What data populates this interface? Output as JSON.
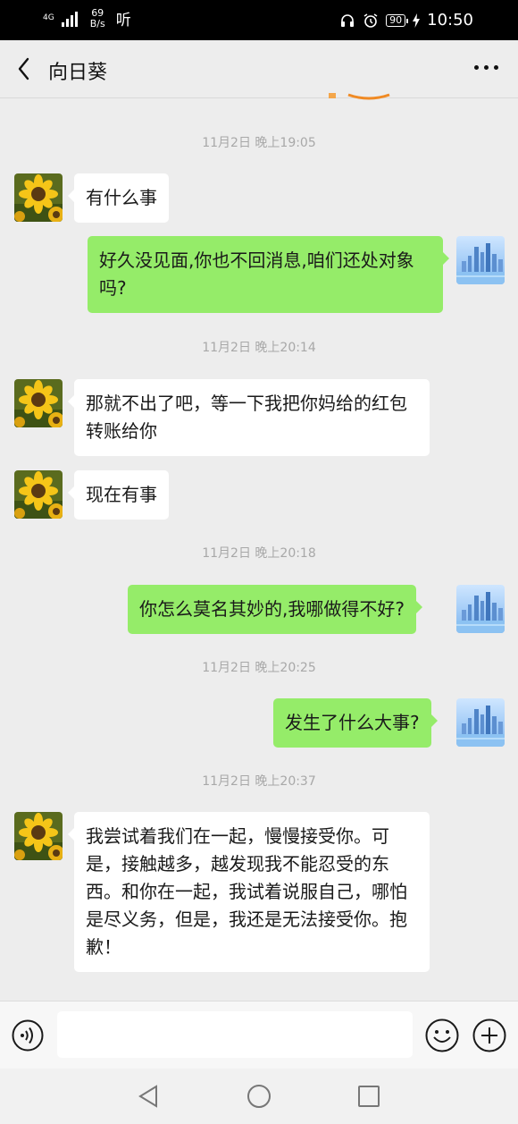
{
  "status_bar": {
    "network_type": "4G",
    "net_speed_value": "69",
    "net_speed_unit": "B/s",
    "hd_label": "听",
    "battery": "90",
    "time": "10:50"
  },
  "header": {
    "title": "向日葵"
  },
  "messages": [
    {
      "type": "time",
      "text": "11月2日 晚上19:05"
    },
    {
      "type": "in",
      "text": "有什么事"
    },
    {
      "type": "out",
      "text": "好久没见面,你也不回消息,咱们还处对象吗?"
    },
    {
      "type": "time",
      "text": "11月2日 晚上20:14"
    },
    {
      "type": "in",
      "text": "那就不出了吧，等一下我把你妈给的红包转账给你"
    },
    {
      "type": "in",
      "text": "现在有事"
    },
    {
      "type": "time",
      "text": "11月2日 晚上20:18"
    },
    {
      "type": "out",
      "text": "你怎么莫名其妙的,我哪做得不好?"
    },
    {
      "type": "time",
      "text": "11月2日 晚上20:25"
    },
    {
      "type": "out",
      "text": "发生了什么大事?"
    },
    {
      "type": "time",
      "text": "11月2日 晚上20:37"
    },
    {
      "type": "in",
      "text": "我尝试着我们在一起，慢慢接受你。可是，接触越多，越发现我不能忍受的东西。和你在一起，我试着说服自己，哪怕是尽义务，但是，我还是无法接受你。抱歉！"
    }
  ],
  "input_bar": {
    "value": "",
    "icons": [
      "voice-icon",
      "emoji-icon",
      "plus-icon"
    ]
  },
  "colors": {
    "background": "#ededed",
    "incoming_bubble": "#ffffff",
    "outgoing_bubble": "#95ec69",
    "timestamp": "#a8a8a8"
  }
}
